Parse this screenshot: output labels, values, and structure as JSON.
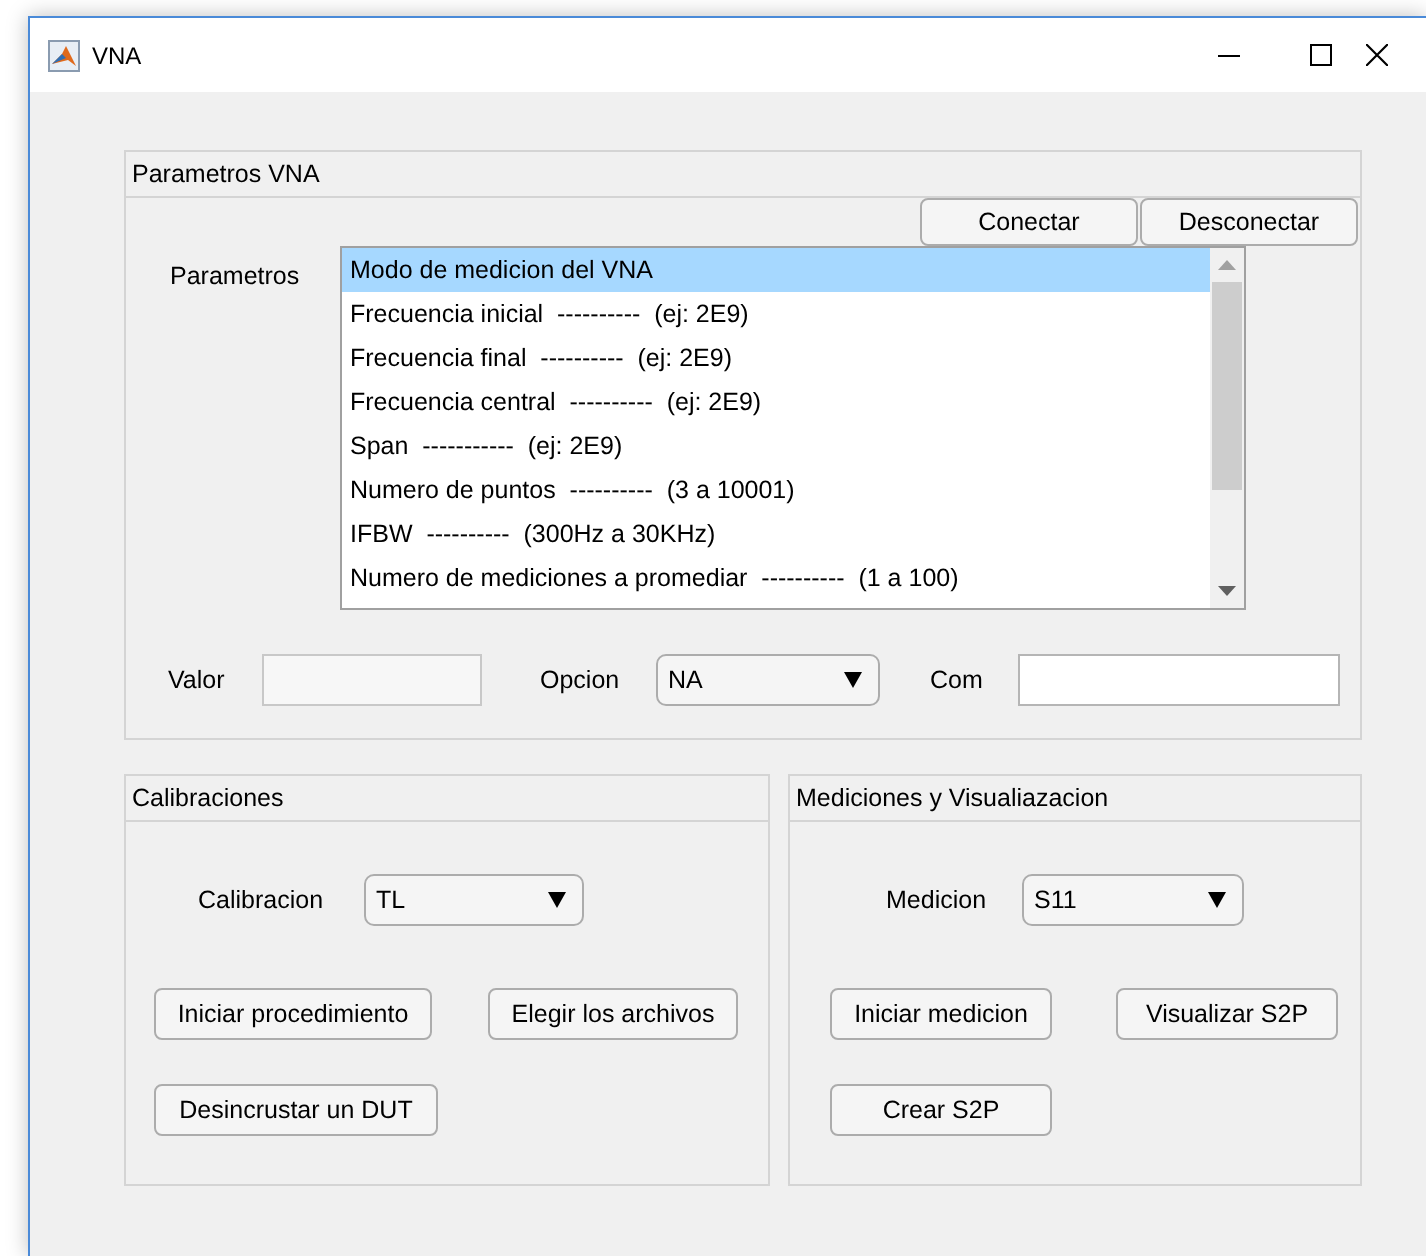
{
  "window": {
    "title": "VNA"
  },
  "parametros_panel": {
    "title": "Parametros VNA",
    "buttons": [
      "Conectar",
      "Desconectar"
    ],
    "list_label": "Parametros",
    "list_items": [
      {
        "label": "Modo de medicion del VNA",
        "selected": true
      },
      {
        "label": "Frecuencia inicial  ----------  (ej: 2E9)",
        "selected": false
      },
      {
        "label": "Frecuencia final  ----------  (ej: 2E9)",
        "selected": false
      },
      {
        "label": "Frecuencia central  ----------  (ej: 2E9)",
        "selected": false
      },
      {
        "label": "Span  -----------  (ej: 2E9)",
        "selected": false
      },
      {
        "label": "Numero de puntos  ----------  (3 a 10001)",
        "selected": false
      },
      {
        "label": "IFBW  ----------  (300Hz a 30KHz)",
        "selected": false
      },
      {
        "label": "Numero de mediciones a promediar  ----------  (1 a 100)",
        "selected": false
      }
    ],
    "controls": [
      {
        "kind": "field",
        "label": "Valor",
        "disabled": true
      },
      {
        "kind": "dropdown",
        "label": "Opcion",
        "value": "NA"
      },
      {
        "kind": "field",
        "label": "Com",
        "disabled": false
      }
    ]
  },
  "calibraciones_panel": {
    "title": "Calibraciones",
    "dropdown": {
      "label": "Calibracion",
      "value": "TL"
    },
    "buttons": [
      "Iniciar procedimiento",
      "Elegir los archivos",
      "Desincrustar un DUT"
    ]
  },
  "mediciones_panel": {
    "title": "Mediciones y Visualiazacion",
    "dropdown": {
      "label": "Medicion",
      "value": "S11"
    },
    "buttons": [
      "Iniciar medicion",
      "Visualizar S2P",
      "Crear S2P"
    ]
  }
}
